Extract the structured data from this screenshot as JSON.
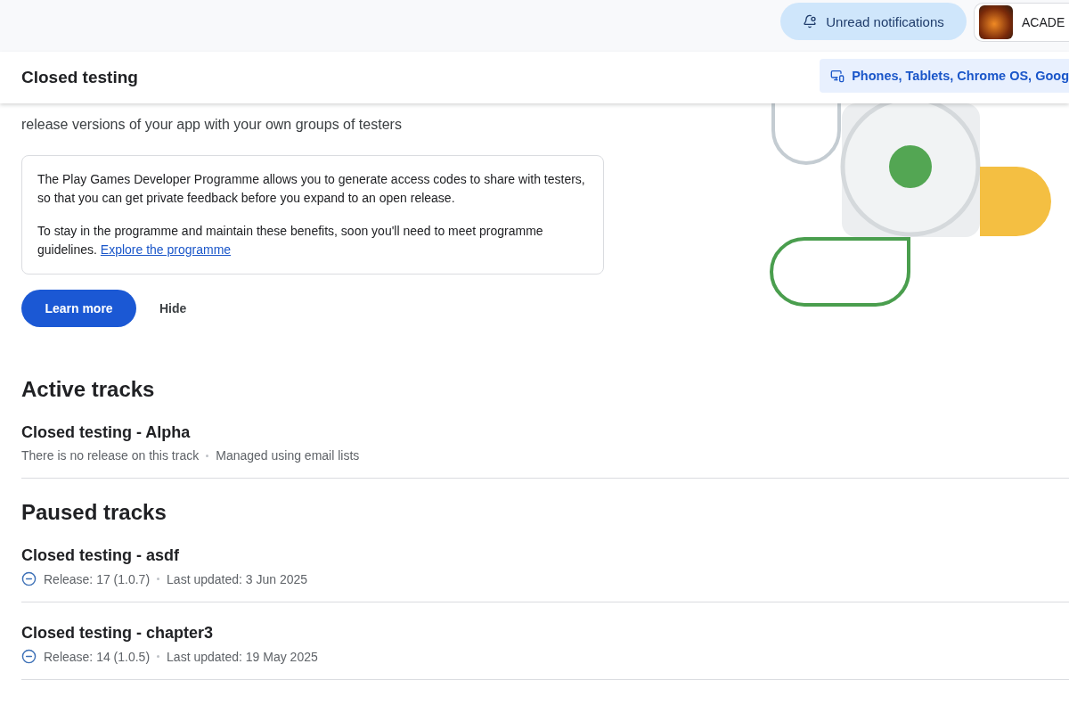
{
  "top_bar": {
    "notifications_button": "Unread notifications",
    "app_name": "ACADE"
  },
  "header": {
    "title": "Closed testing",
    "platform_chip": "Phones, Tablets, Chrome OS, Goog"
  },
  "intro": "release versions of your app with your own groups of testers",
  "info_card": {
    "paragraphs": [
      "The Play Games Developer Programme allows you to generate access codes to share with testers, so that you can get private feedback before you expand to an open release.",
      "To stay in the programme and maintain these benefits, soon you'll need to meet programme guidelines."
    ],
    "link": "Explore the programme"
  },
  "actions": {
    "primary": "Learn more",
    "secondary": "Hide"
  },
  "sections": [
    {
      "title": "Active tracks",
      "tracks": [
        {
          "name": "Closed testing - Alpha",
          "paused": false,
          "meta": [
            "There is no release on this track",
            "Managed using email lists"
          ]
        }
      ]
    },
    {
      "title": "Paused tracks",
      "tracks": [
        {
          "name": "Closed testing - asdf",
          "paused": true,
          "meta": [
            "Release: 17 (1.0.7)",
            "Last updated: 3 Jun 2025"
          ]
        },
        {
          "name": "Closed testing - chapter3",
          "paused": true,
          "meta": [
            "Release: 14 (1.0.5)",
            "Last updated: 19 May 2025"
          ]
        }
      ]
    }
  ]
}
